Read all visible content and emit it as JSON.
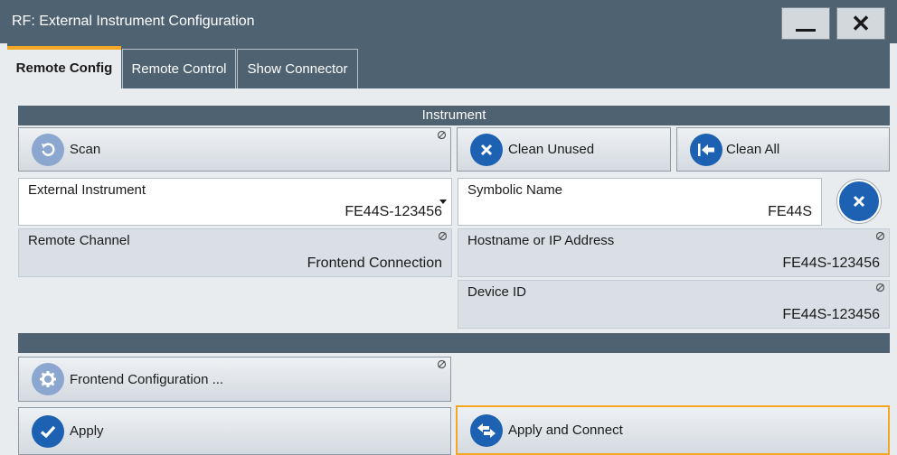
{
  "window": {
    "title": "RF: External Instrument Configuration",
    "minimize_icon": "minimize-icon",
    "close_icon": "close-icon",
    "close_label": "✕"
  },
  "tabs": [
    {
      "label": "Remote Config",
      "active": true
    },
    {
      "label": "Remote Control",
      "active": false
    },
    {
      "label": "Show Connector",
      "active": false
    }
  ],
  "instrument": {
    "section_title": "Instrument",
    "scan_label": "Scan",
    "clean_unused_label": "Clean Unused",
    "clean_all_label": "Clean All",
    "external_instrument": {
      "label": "External Instrument",
      "value": "FE44S-123456"
    },
    "symbolic_name": {
      "label": "Symbolic Name",
      "value": "FE44S"
    },
    "remote_channel": {
      "label": "Remote Channel",
      "value": "Frontend Connection"
    },
    "hostname": {
      "label": "Hostname or IP Address",
      "value": "FE44S-123456"
    },
    "device_id": {
      "label": "Device ID",
      "value": "FE44S-123456"
    }
  },
  "actions": {
    "frontend_config_label": "Frontend Configuration ...",
    "apply_label": "Apply",
    "apply_connect_label": "Apply and Connect"
  },
  "colors": {
    "titlebar": "#4f6271",
    "accent_orange": "#f5a623",
    "icon_blue": "#1d61b3",
    "icon_light_blue": "#8ba6cf"
  }
}
